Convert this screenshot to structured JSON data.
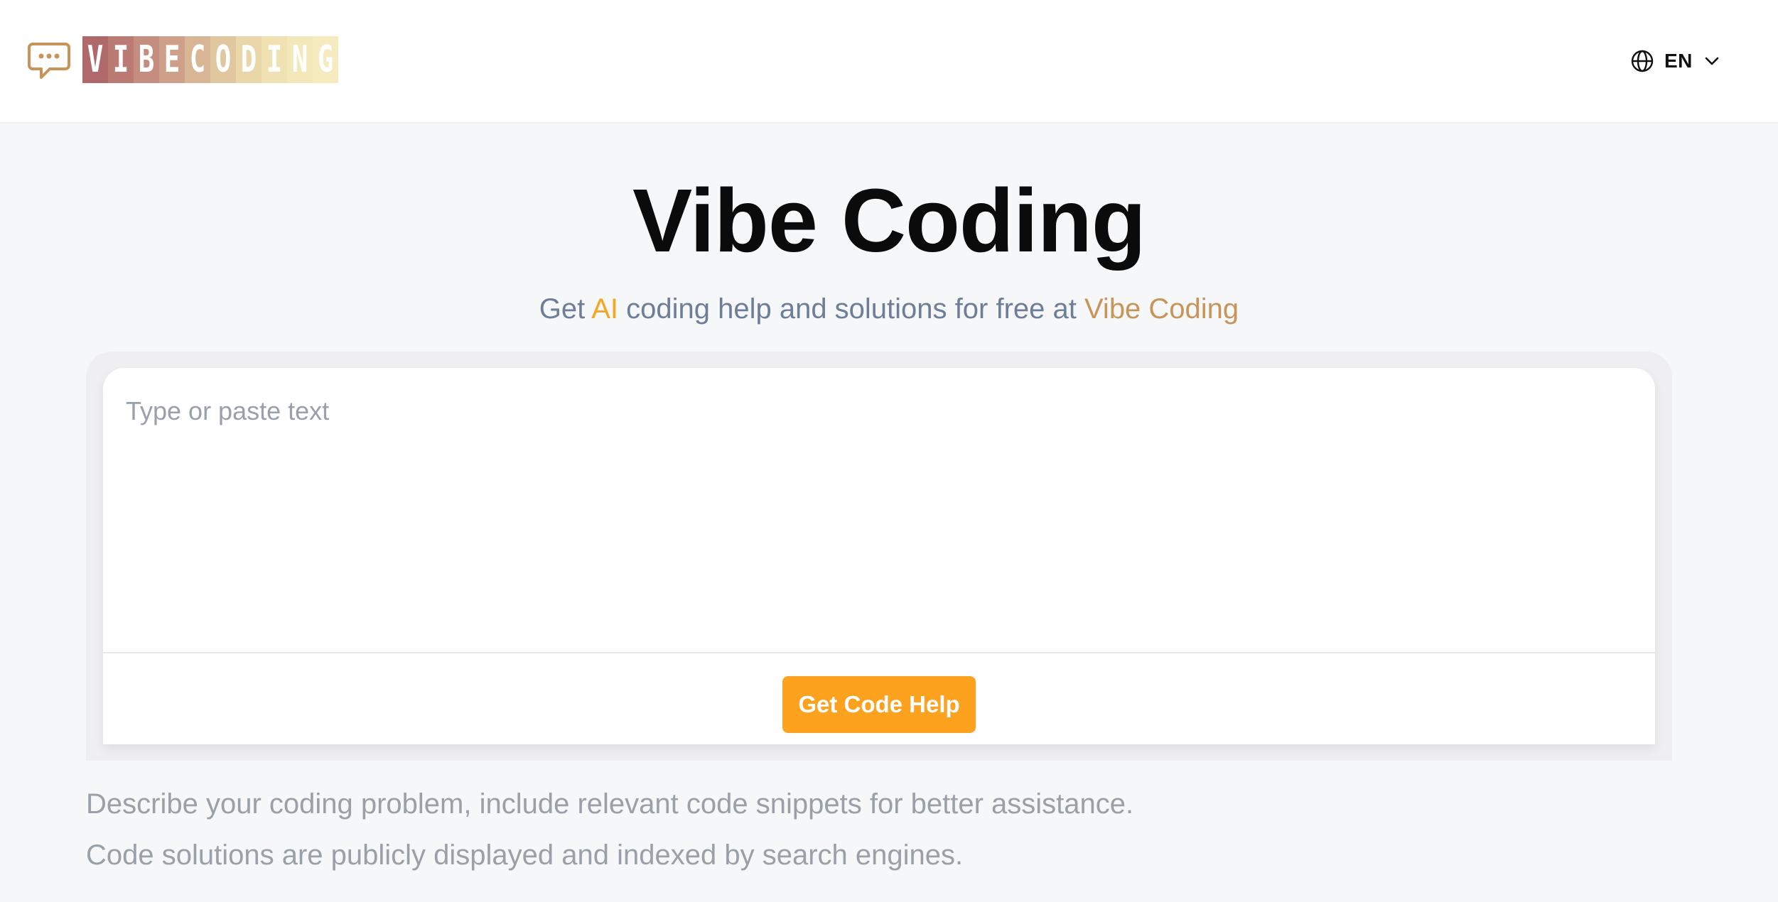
{
  "header": {
    "logo_letters": [
      "V",
      "I",
      "B",
      "E",
      "C",
      "O",
      "D",
      "I",
      "N",
      "G"
    ],
    "logo_colors": [
      "#b0696b",
      "#bb7a74",
      "#c58d80",
      "#cea08a",
      "#d8b595",
      "#e1c79f",
      "#e9d7a9",
      "#efe1b2",
      "#f3e8ba",
      "#f5ebbf"
    ],
    "language_label": "EN",
    "language_icon": "globe-icon",
    "dropdown_icon": "chevron-down-icon",
    "logo_icon": "chat-bubble-icon"
  },
  "hero": {
    "title": "Vibe Coding",
    "subtitle_prefix": "Get ",
    "subtitle_ai": "AI",
    "subtitle_middle": " coding help and solutions for free at ",
    "subtitle_brand": "Vibe Coding"
  },
  "editor": {
    "placeholder": "Type or paste text",
    "submit_label": "Get Code Help"
  },
  "hints": {
    "line1": "Describe your coding problem, include relevant code snippets for better assistance.",
    "line2": "Code solutions are publicly displayed and indexed by search engines."
  },
  "colors": {
    "accent": "#fca21f",
    "ai_highlight": "#f5a623",
    "brand_highlight": "#c9945a",
    "subtitle_text": "#6e7d98"
  }
}
